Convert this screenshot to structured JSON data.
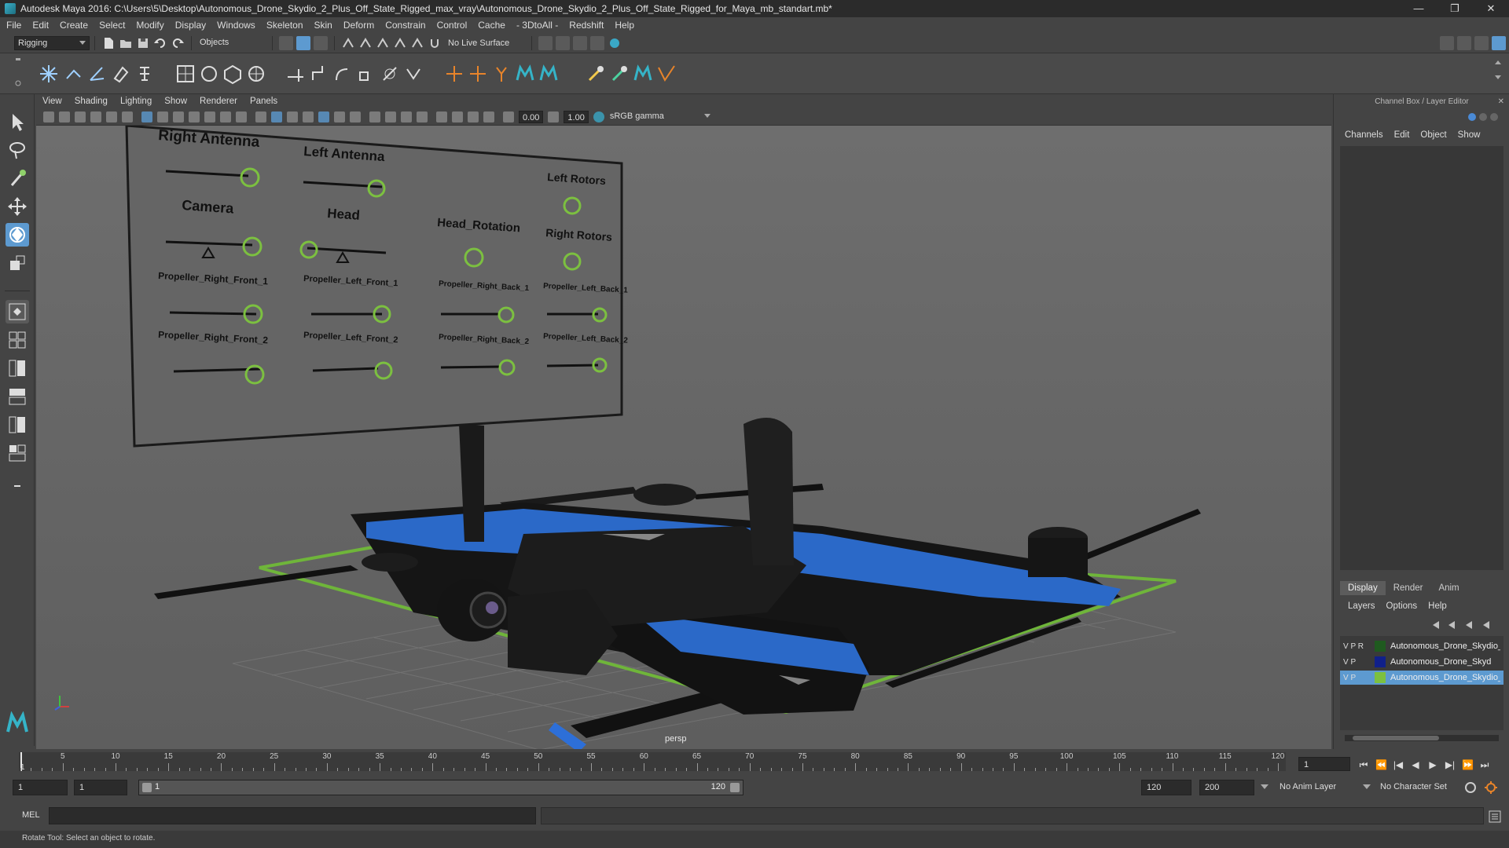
{
  "window": {
    "title": "Autodesk Maya 2016: C:\\Users\\5\\Desktop\\Autonomous_Drone_Skydio_2_Plus_Off_State_Rigged_max_vray\\Autonomous_Drone_Skydio_2_Plus_Off_State_Rigged_for_Maya_mb_standart.mb*",
    "controls": [
      "—",
      "❐",
      "✕"
    ]
  },
  "menubar": [
    "File",
    "Edit",
    "Create",
    "Select",
    "Modify",
    "Display",
    "Windows",
    "Skeleton",
    "Skin",
    "Deform",
    "Constrain",
    "Control",
    "Cache",
    "- 3DtoAll -",
    "Redshift",
    "Help"
  ],
  "statusline": {
    "menuset": "Rigging",
    "selection_mode": "Objects",
    "live_surface": "No Live Surface"
  },
  "viewport": {
    "menu": [
      "View",
      "Shading",
      "Lighting",
      "Show",
      "Renderer",
      "Panels"
    ],
    "exposure": "0.00",
    "gamma": "1.00",
    "color_space": "sRGB gamma",
    "camera_label": "persp",
    "rig_board": {
      "labels": {
        "right_antenna": "Right Antenna",
        "left_antenna": "Left Antenna",
        "camera": "Camera",
        "head": "Head",
        "head_rotation": "Head_Rotation",
        "left_rotors": "Left Rotors",
        "right_rotors": "Right Rotors",
        "prop_rf1": "Propeller_Right_Front_1",
        "prop_lf1": "Propeller_Left_Front_1",
        "prop_rb1": "Propeller_Right_Back_1",
        "prop_lb1": "Propeller_Left_Back_1",
        "prop_rf2": "Propeller_Right_Front_2",
        "prop_lf2": "Propeller_Left_Front_2",
        "prop_rb2": "Propeller_Right_Back_2",
        "prop_lb2": "Propeller_Left_Back_2"
      }
    }
  },
  "right_panel": {
    "title": "Channel Box / Layer Editor",
    "menu": [
      "Channels",
      "Edit",
      "Object",
      "Show"
    ],
    "tabs": [
      "Display",
      "Render",
      "Anim"
    ],
    "layer_menu": [
      "Layers",
      "Options",
      "Help"
    ],
    "layers": [
      {
        "flags": "V P R",
        "name": "Autonomous_Drone_Skydio_",
        "color": "#1f5a1f"
      },
      {
        "flags": "V P",
        "name": "Autonomous_Drone_Skyd",
        "color": "#10208a"
      },
      {
        "flags": "V P",
        "name": "Autonomous_Drone_Skydio_",
        "color": "#7cc040"
      }
    ]
  },
  "timeline": {
    "ticks": [
      "5",
      "10",
      "15",
      "20",
      "25",
      "30",
      "35",
      "40",
      "45",
      "50",
      "55",
      "60",
      "65",
      "70",
      "75",
      "80",
      "85",
      "90",
      "95",
      "100",
      "105",
      "110",
      "115",
      "120"
    ],
    "first_label": "1",
    "current_frame": "1",
    "playback_buttons": [
      "⏮",
      "⏪",
      "|◀",
      "◀",
      "▶",
      "▶|",
      "⏩",
      "⏭"
    ]
  },
  "range": {
    "start": "1",
    "start2": "1",
    "slider_start": "1",
    "slider_end": "120",
    "end": "120",
    "end2": "200",
    "anim_layer": "No Anim Layer",
    "character_set": "No Character Set"
  },
  "cmdline": {
    "label": "MEL"
  },
  "helpline": {
    "text": "Rotate Tool: Select an object to rotate."
  }
}
